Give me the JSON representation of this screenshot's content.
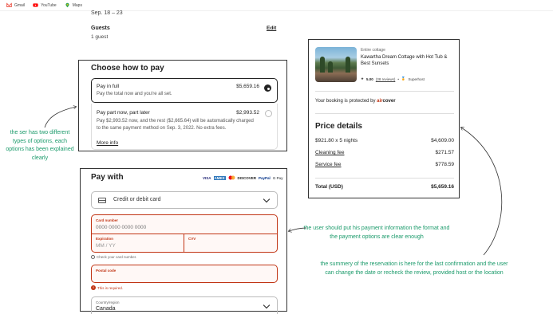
{
  "bookmarks": [
    {
      "label": "Gmail",
      "icon": "gmail-icon",
      "color": "#ea4335"
    },
    {
      "label": "YouTube",
      "icon": "youtube-icon",
      "color": "#ff0000"
    },
    {
      "label": "Maps",
      "icon": "maps-icon",
      "color": "#34a853"
    }
  ],
  "trip": {
    "dates_value": "Sep. 18 – 23",
    "guests_label": "Guests",
    "guests_value": "1 guest",
    "edit_label": "Edit"
  },
  "choose_pay": {
    "title": "Choose how to pay",
    "full": {
      "title": "Pay in full",
      "price": "$5,659.16",
      "desc": "Pay the total now and you're all set."
    },
    "part": {
      "title": "Pay part now, part later",
      "price": "$2,993.52",
      "desc": "Pay $2,993.52 now, and the rest ($2,665.64) will be automatically charged to the same payment method on Sep. 3, 2022. No extra fees.",
      "more_info": "More info"
    }
  },
  "pay_with": {
    "title": "Pay with",
    "card_brands": [
      "VISA",
      "AMEX",
      "MC",
      "DISCOVER",
      "PayPal",
      "G Pay"
    ],
    "method_label": "Credit or debit card",
    "card_number_label": "Card number",
    "card_number_placeholder": "0000 0000 0000 0000",
    "expiration_label": "Expiration",
    "expiration_placeholder": "MM / YY",
    "cvv_label": "CVV",
    "hint": "Check your card number.",
    "postal_label": "Postal code",
    "required_msg": "This is required.",
    "country_label": "Country/region",
    "country_value": "Canada"
  },
  "summary": {
    "listing_type": "Entire cottage",
    "listing_title": "Kawartha Dream Cottage with Hot Tub & Best Sunsets",
    "rating": "5.00",
    "reviews": "(38 reviews)",
    "superhost": "Superhost",
    "protected_text": "Your booking is protected by",
    "aircover_air": "air",
    "aircover_cover": "cover",
    "price_title": "Price details",
    "rows": [
      {
        "label": "$921.80 x 5 nights",
        "value": "$4,609.00"
      },
      {
        "label": "Cleaning fee",
        "value": "$271.57"
      },
      {
        "label": "Service fee",
        "value": "$778.59"
      }
    ],
    "total_label": "Total (USD)",
    "total_value": "$5,659.16"
  },
  "annotations": {
    "note1": "the ser has two different types of options, each options has been explained clearly",
    "note2": "the user should put his payment information the format and the payment options are clear enough",
    "note3": "the summery of the reservation is here for the last confirmation and the user can change the date or recheck the review, provided host or the location"
  },
  "colors": {
    "accent_error": "#c13515",
    "annotation": "#1a9a6a"
  }
}
